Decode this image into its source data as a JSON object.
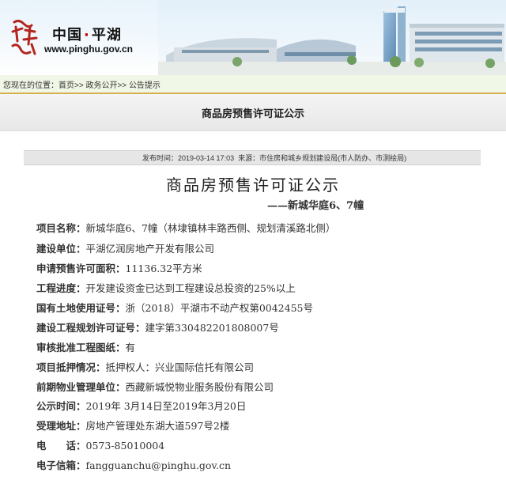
{
  "header": {
    "site_name_part1": "中国",
    "site_name_dot": "·",
    "site_name_part2": "平湖",
    "site_url": "www.pinghu.gov.cn"
  },
  "breadcrumb": {
    "prefix": "您现在的位置：",
    "items": [
      "首页",
      "政务公开",
      "公告提示"
    ],
    "separator": ">>"
  },
  "section_title": "商品房预售许可证公示",
  "meta": {
    "publish_label": "发布时间：",
    "publish_time": "2019-03-14 17:03",
    "source_label": "来源：",
    "source": "市住房和城乡规划建设局(市人防办、市测绘局)"
  },
  "article": {
    "title": "商品房预售许可证公示",
    "subtitle": "——新城华庭6、7幢",
    "fields": [
      {
        "label": "项目名称：",
        "value": "新城华庭6、7幢（林埭镇林丰路西侧、规划清溪路北侧）"
      },
      {
        "label": "建设单位：",
        "value": "平湖亿润房地产开发有限公司"
      },
      {
        "label": "申请预售许可面积：",
        "value": "11136.32平方米"
      },
      {
        "label": "工程进度：",
        "value": "开发建设资金已达到工程建设总投资的25%以上"
      },
      {
        "label": "国有土地使用证号：",
        "value": "浙（2018）平湖市不动产权第0042455号"
      },
      {
        "label": "建设工程规划许可证号：",
        "value": "建字第330482201808007号"
      },
      {
        "label": "审核批准工程图纸：",
        "value": "有"
      },
      {
        "label": "项目抵押情况：",
        "value": "抵押权人：兴业国际信托有限公司"
      },
      {
        "label": "前期物业管理单位：",
        "value": "西藏新城悦物业服务股份有限公司"
      },
      {
        "label": "公示时间：",
        "value": "2019年 3月14日至2019年3月20日"
      },
      {
        "label": "受理地址：",
        "value": "房地产管理处东湖大道597号2楼"
      },
      {
        "label": "电　　话：",
        "value": "0573-85010004"
      },
      {
        "label": "电子信箱：",
        "value": "fangguanchu@pinghu.gov.cn"
      }
    ]
  },
  "colors": {
    "breadcrumb_bg": "#f1f7e6",
    "breadcrumb_border": "#d8b04d",
    "site_dot": "#cc0000"
  },
  "icons": {
    "seal": "red-calligraphy-seal-icon"
  }
}
